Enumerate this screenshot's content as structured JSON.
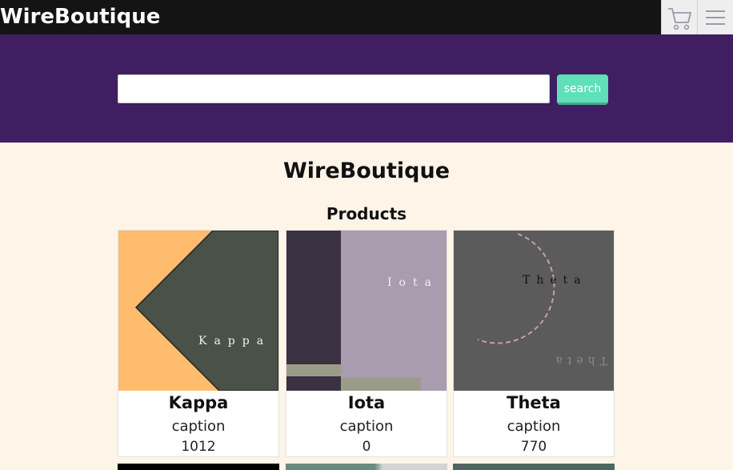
{
  "header": {
    "brand": "WireBoutique",
    "cart_icon": "cart-icon",
    "menu_icon": "hamburger-menu-icon"
  },
  "search": {
    "value": "",
    "placeholder": "",
    "button_label": "search"
  },
  "main": {
    "site_title": "WireBoutique",
    "section_title": "Products"
  },
  "products": [
    {
      "name": "Kappa",
      "caption": "caption",
      "price": "1012",
      "image_text": "Kappa"
    },
    {
      "name": "Iota",
      "caption": "caption",
      "price": "0",
      "image_text": "Iota"
    },
    {
      "name": "Theta",
      "caption": "caption",
      "price": "770",
      "image_text": "Theta"
    }
  ],
  "colors": {
    "topbar": "#141414",
    "hero": "#3f1f62",
    "search_button": "#5fe0b8",
    "page_background": "#fff4e8"
  }
}
